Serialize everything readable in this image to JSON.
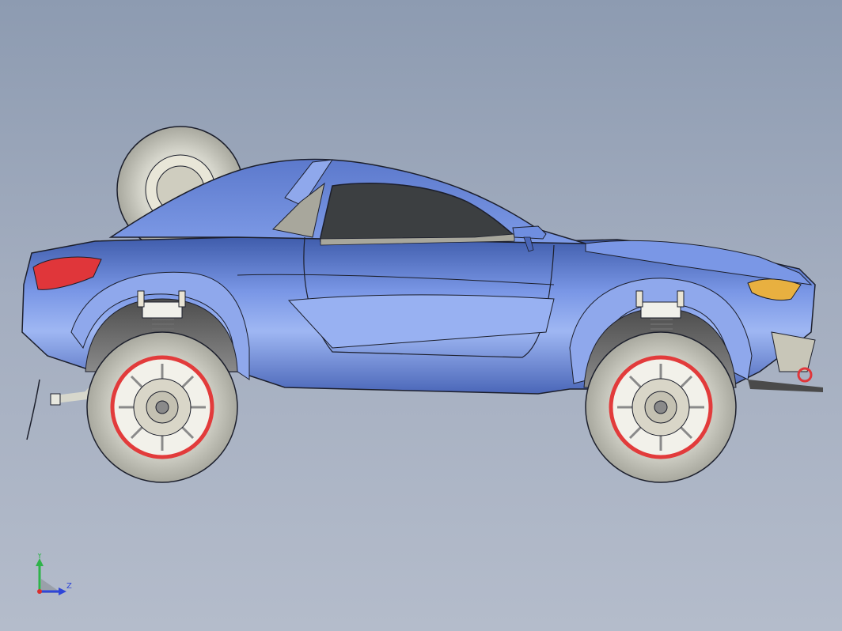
{
  "viewport": {
    "background_top": "#8d9bb1",
    "background_bottom": "#b4bccb"
  },
  "model": {
    "body_color": "#6f8ee0",
    "body_highlight": "#a9c0f6",
    "body_shadow": "#3f5cab",
    "glass_color": "#3c3f41",
    "interior_color": "#a8a79c",
    "tire_color": "#c9c9bf",
    "rim_color": "#e23b3b",
    "taillight_color": "#e0363a",
    "headlight_color": "#e8b040",
    "outline_color": "#1c1f2c"
  },
  "triad": {
    "y_label": "Y",
    "z_label": "Z",
    "y_color": "#2fb34a",
    "z_color": "#2f46d9",
    "x_color": "#d92f2f"
  }
}
